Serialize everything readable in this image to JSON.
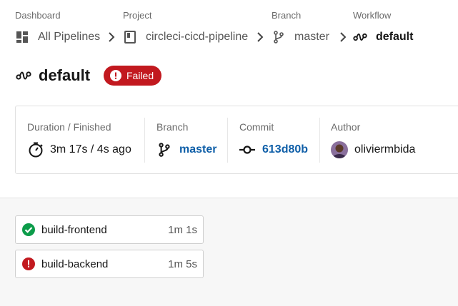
{
  "breadcrumbs": [
    {
      "label": "Dashboard",
      "value": "All Pipelines",
      "icon": "dashboard-icon"
    },
    {
      "label": "Project",
      "value": "circleci-cicd-pipeline",
      "icon": "project-book-icon"
    },
    {
      "label": "Branch",
      "value": "master",
      "icon": "branch-icon"
    },
    {
      "label": "Workflow",
      "value": "default",
      "icon": "workflow-icon"
    }
  ],
  "workflow": {
    "title": "default",
    "status": "Failed",
    "status_color": "#c2191f"
  },
  "info": {
    "duration_label": "Duration / Finished",
    "duration_value": "3m 17s / 4s ago",
    "branch_label": "Branch",
    "branch_value": "master",
    "commit_label": "Commit",
    "commit_value": "613d80b",
    "author_label": "Author",
    "author_value": "oliviermbida"
  },
  "jobs": [
    {
      "name": "build-frontend",
      "duration": "1m 1s",
      "status": "success",
      "color": "#0c9c4a"
    },
    {
      "name": "build-backend",
      "duration": "1m 5s",
      "status": "failed",
      "color": "#c2191f"
    }
  ],
  "colors": {
    "link": "#0f5fa8",
    "success": "#0c9c4a",
    "failed": "#c2191f"
  }
}
